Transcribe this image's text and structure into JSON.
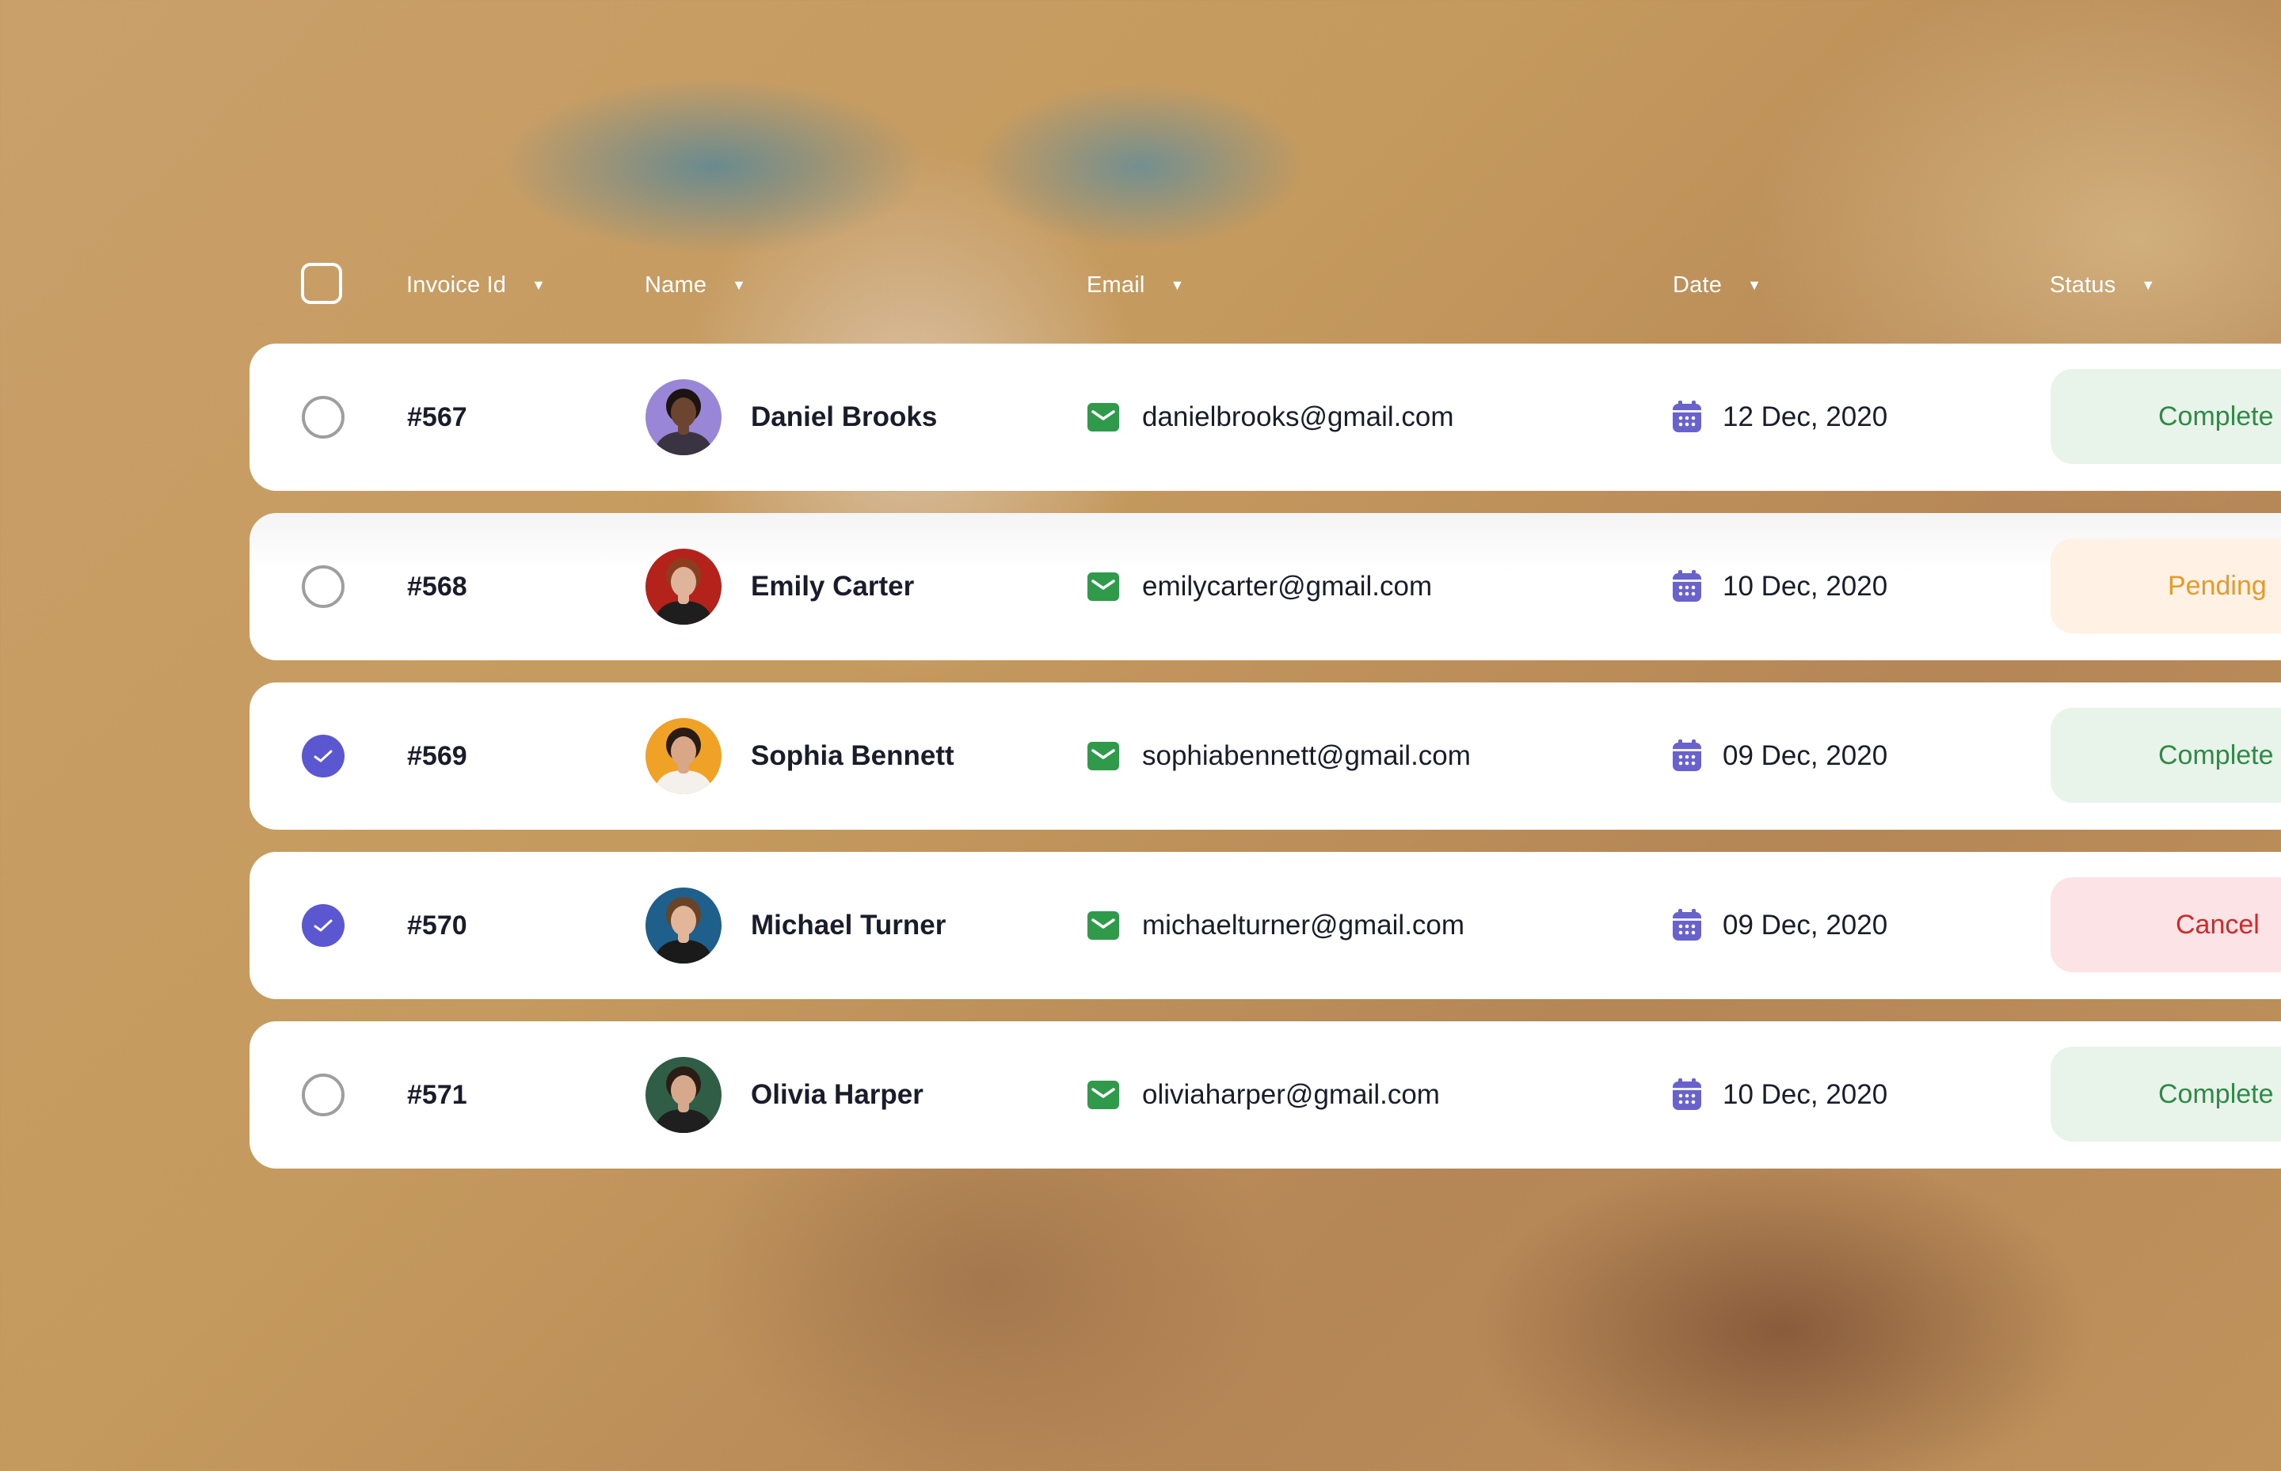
{
  "header": {
    "invoice_id": "Invoice Id",
    "name": "Name",
    "email": "Email",
    "date": "Date",
    "status": "Status"
  },
  "rows": [
    {
      "checked": false,
      "invoice": "#567",
      "name": "Daniel Brooks",
      "email": "danielbrooks@gmail.com",
      "date": "12 Dec, 2020",
      "status": "Complete",
      "status_type": "complete",
      "avatar_bg": "#9a86d6",
      "skin": "#6b4530",
      "hair": "#1d1411",
      "shirt": "#3a3442"
    },
    {
      "checked": false,
      "invoice": "#568",
      "name": "Emily Carter",
      "email": "emilycarter@gmail.com",
      "date": "10 Dec, 2020",
      "status": "Pending",
      "status_type": "pending",
      "avatar_bg": "#b3231c",
      "skin": "#e0b49a",
      "hair": "#8c3d1d",
      "shirt": "#1e1e1e"
    },
    {
      "checked": true,
      "invoice": "#569",
      "name": "Sophia Bennett",
      "email": "sophiabennett@gmail.com",
      "date": "09 Dec, 2020",
      "status": "Complete",
      "status_type": "complete",
      "avatar_bg": "#f0a226",
      "skin": "#d9a688",
      "hair": "#2a1b14",
      "shirt": "#f4f1ec"
    },
    {
      "checked": true,
      "invoice": "#570",
      "name": "Michael Turner",
      "email": "michaelturner@gmail.com",
      "date": "09 Dec, 2020",
      "status": "Cancel",
      "status_type": "cancel",
      "avatar_bg": "#1e5f8c",
      "skin": "#e3b69a",
      "hair": "#6a4226",
      "shirt": "#1a1a1a"
    },
    {
      "checked": false,
      "invoice": "#571",
      "name": "Olivia Harper",
      "email": "oliviaharper@gmail.com",
      "date": "10 Dec, 2020",
      "status": "Complete",
      "status_type": "complete",
      "avatar_bg": "#2f5d46",
      "skin": "#d6a98c",
      "hair": "#2b1d15",
      "shirt": "#1f1f1f"
    }
  ],
  "icons": {
    "mail": "mail-icon",
    "calendar": "calendar-icon",
    "sort": "caret-down-icon"
  },
  "colors": {
    "accent": "#5b57d1",
    "mail_green": "#2e9a4a",
    "calendar_purple": "#6a62cc"
  }
}
